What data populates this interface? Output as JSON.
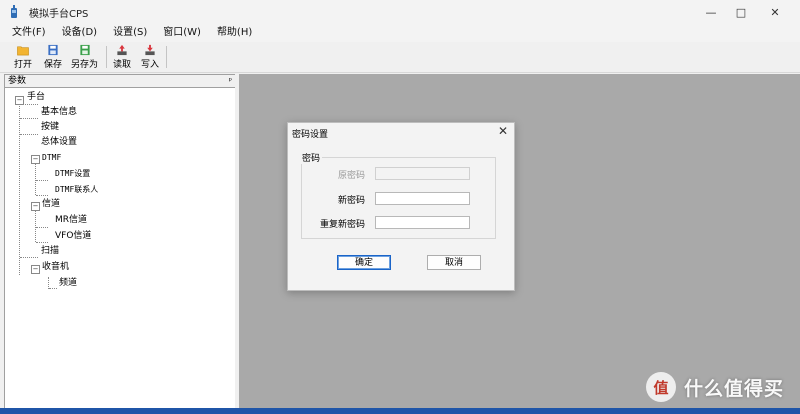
{
  "window": {
    "title": "模拟手台CPS",
    "min_icon": "minimize-icon",
    "max_icon": "maximize-icon",
    "close_icon": "close-icon"
  },
  "menu": [
    "文件(F)",
    "设备(D)",
    "设置(S)",
    "窗口(W)",
    "帮助(H)"
  ],
  "toolbar": {
    "open": "打开",
    "save": "保存",
    "save_as": "另存为",
    "read": "读取",
    "write": "写入"
  },
  "panel": {
    "title": "参数",
    "pin": "ᵖ"
  },
  "tree": {
    "root": "手台",
    "basic": "基本信息",
    "keys": "按键",
    "general": "总体设置",
    "dtmf": "DTMF",
    "dtmf_settings": "DTMF设置",
    "dtmf_contacts": "DTMF联系人",
    "channels": "信道",
    "mr_channel": "MR信道",
    "vfo_channel": "VFO信道",
    "scan": "扫描",
    "radio": "收音机",
    "frequency": "频道",
    "expand_minus": "−"
  },
  "dialog": {
    "title": "密码设置",
    "group": "密码",
    "old_password_label": "原密码",
    "new_password_label": "新密码",
    "repeat_password_label": "重复新密码",
    "old_password_value": "",
    "new_password_value": "",
    "repeat_password_value": "",
    "ok": "确定",
    "cancel": "取消"
  },
  "watermark": {
    "badge": "值",
    "text": "什么值得买"
  },
  "colors": {
    "accent": "#1a64c8",
    "workspace": "#a9a9a9",
    "desktop": "#2a5fb0"
  }
}
